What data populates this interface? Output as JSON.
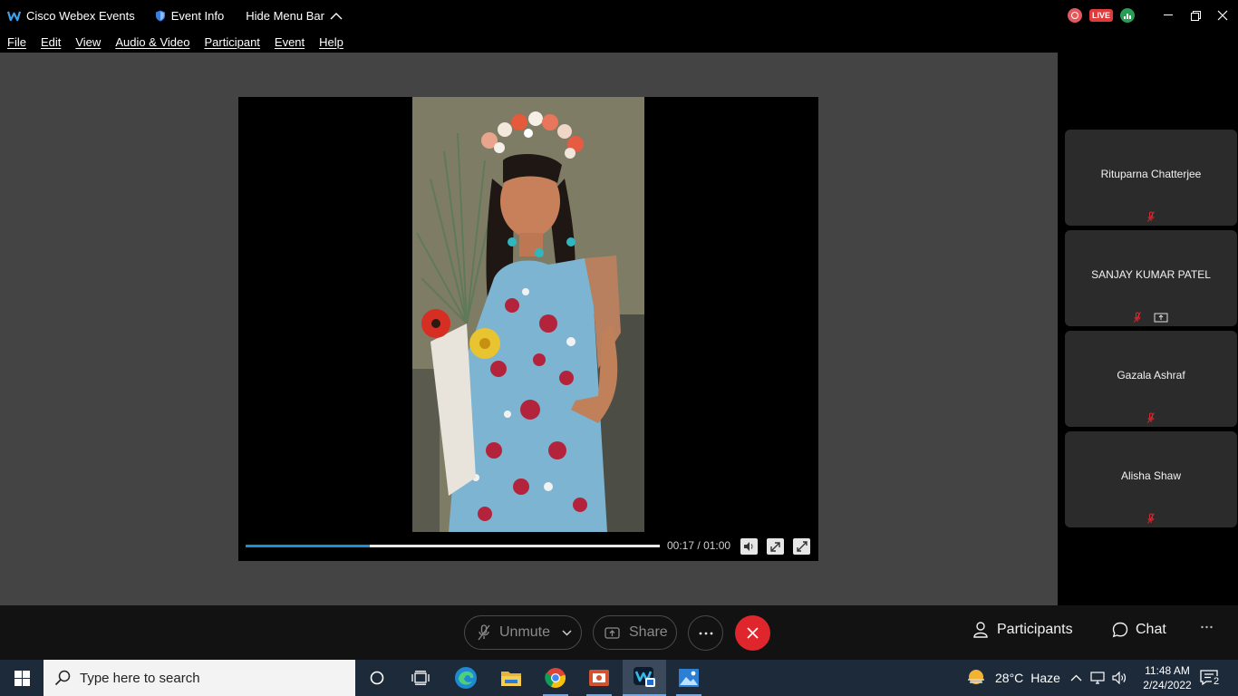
{
  "titlebar": {
    "app_name": "Cisco Webex Events",
    "event_info": "Event Info",
    "hide_menu": "Hide Menu Bar",
    "live_badge": "LIVE"
  },
  "menubar": {
    "items": [
      "File",
      "Edit",
      "View",
      "Audio & Video",
      "Participant",
      "Event",
      "Help"
    ]
  },
  "player": {
    "current_time": "00:17",
    "separator": "/",
    "duration": "01:00",
    "progress_fraction": 0.3
  },
  "participants": [
    {
      "name": "Rituparna Chatterjee",
      "muted": true,
      "sharing": false
    },
    {
      "name": "SANJAY KUMAR PATEL",
      "muted": true,
      "sharing": true
    },
    {
      "name": "Gazala Ashraf",
      "muted": true,
      "sharing": false
    },
    {
      "name": "Alisha Shaw",
      "muted": true,
      "sharing": false
    }
  ],
  "controls": {
    "unmute": "Unmute",
    "share": "Share",
    "participants": "Participants",
    "chat": "Chat"
  },
  "taskbar": {
    "search_placeholder": "Type here to search",
    "weather": "28°C",
    "weather_desc": "Haze",
    "time": "11:48 AM",
    "date": "2/24/2022",
    "notification_count": "2"
  },
  "colors": {
    "stage_bg": "#444444",
    "progress": "#1a8fd6",
    "end_call": "#e0262d",
    "mute_indicator": "#e0262d",
    "taskbar": "#1c2a3a"
  }
}
